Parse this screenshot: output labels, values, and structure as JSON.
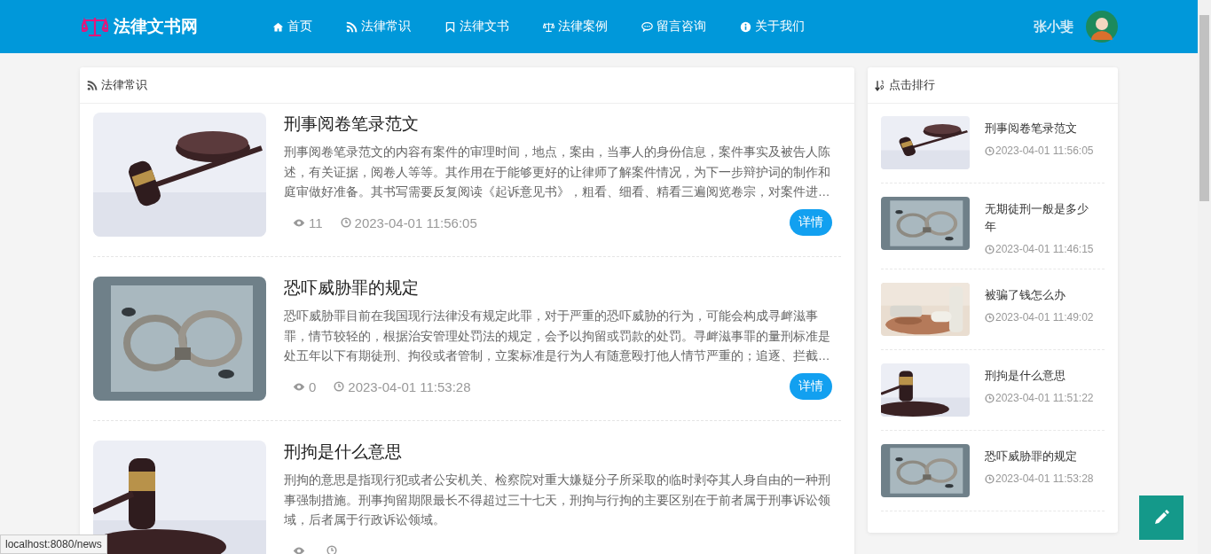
{
  "header": {
    "logo": "法律文书网",
    "nav": [
      {
        "label": "首页"
      },
      {
        "label": "法律常识"
      },
      {
        "label": "法律文书"
      },
      {
        "label": "法律案例"
      },
      {
        "label": "留言咨询"
      },
      {
        "label": "关于我们"
      }
    ],
    "user": {
      "name": "张小斐"
    }
  },
  "main": {
    "title": "法律常识",
    "articles": [
      {
        "title": "刑事阅卷笔录范文",
        "excerpt": "刑事阅卷笔录范文的内容有案件的审理时间，地点，案由，当事人的身份信息，案件事实及被告人陈述，有关证据，阅卷人等等。其作用在于能够更好的让律师了解案件情况，为下一步辩护词的制作和庭审做好准备。其书写需要反复阅读《起诉意见书》，粗看、细看、精看三遍阅览卷宗，对案件进…",
        "views": "11",
        "time": "2023-04-01 11:56:05",
        "button": "详情"
      },
      {
        "title": "恐吓威胁罪的规定",
        "excerpt": "恐吓威胁罪目前在我国现行法律没有规定此罪，对于严重的恐吓威胁的行为，可能会构成寻衅滋事罪，情节较轻的，根据治安管理处罚法的规定，会予以拘留或罚款的处罚。寻衅滋事罪的量刑标准是处五年以下有期徒刑、拘役或者管制，立案标准是行为人有随意殴打他人情节严重的；追逐、拦截…",
        "views": "0",
        "time": "2023-04-01 11:53:28",
        "button": "详情"
      },
      {
        "title": "刑拘是什么意思",
        "excerpt": "刑拘的意思是指现行犯或者公安机关、检察院对重大嫌疑分子所采取的临时剥夺其人身自由的一种刑事强制措施。刑事拘留期限最长不得超过三十七天，刑拘与行拘的主要区别在于前者属于刑事诉讼领域，后者属于行政诉讼领域。"
      }
    ]
  },
  "sidebar": {
    "title": "点击排行",
    "items": [
      {
        "title": "刑事阅卷笔录范文",
        "time": "2023-04-01 11:56:05"
      },
      {
        "title": "无期徒刑一般是多少年",
        "time": "2023-04-01 11:46:15"
      },
      {
        "title": "被骗了钱怎么办",
        "time": "2023-04-01 11:49:02"
      },
      {
        "title": "刑拘是什么意思",
        "time": "2023-04-01 11:51:22"
      },
      {
        "title": "恐吓威胁罪的规定",
        "time": "2023-04-01 11:53:28"
      }
    ]
  },
  "status_bar": "localhost:8080/news"
}
